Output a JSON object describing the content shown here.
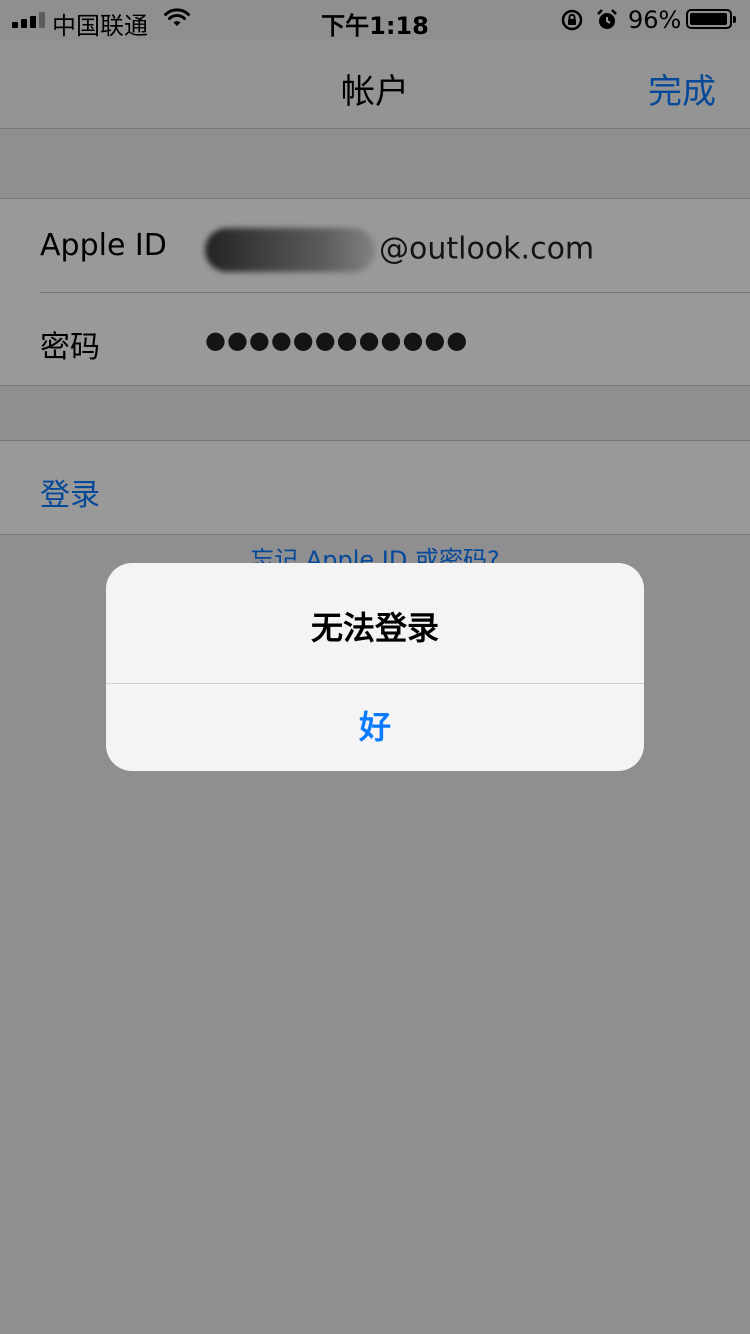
{
  "status_bar": {
    "carrier": "中国联通",
    "time": "下午1:18",
    "battery_percent": "96%",
    "battery_level": 0.96
  },
  "nav": {
    "title": "帐户",
    "done_label": "完成"
  },
  "account": {
    "apple_id_label": "Apple ID",
    "apple_id_domain": "@outlook.com",
    "password_label": "密码",
    "password_value": "●●●●●●●●●●●●"
  },
  "login": {
    "button_label": "登录",
    "forgot_link": "忘记 Apple ID 或密码?"
  },
  "alert": {
    "title": "无法登录",
    "ok_label": "好"
  },
  "colors": {
    "accent": "#0a7aff",
    "background": "#efeff4",
    "dim_overlay": "rgba(0,0,0,0.40)"
  }
}
